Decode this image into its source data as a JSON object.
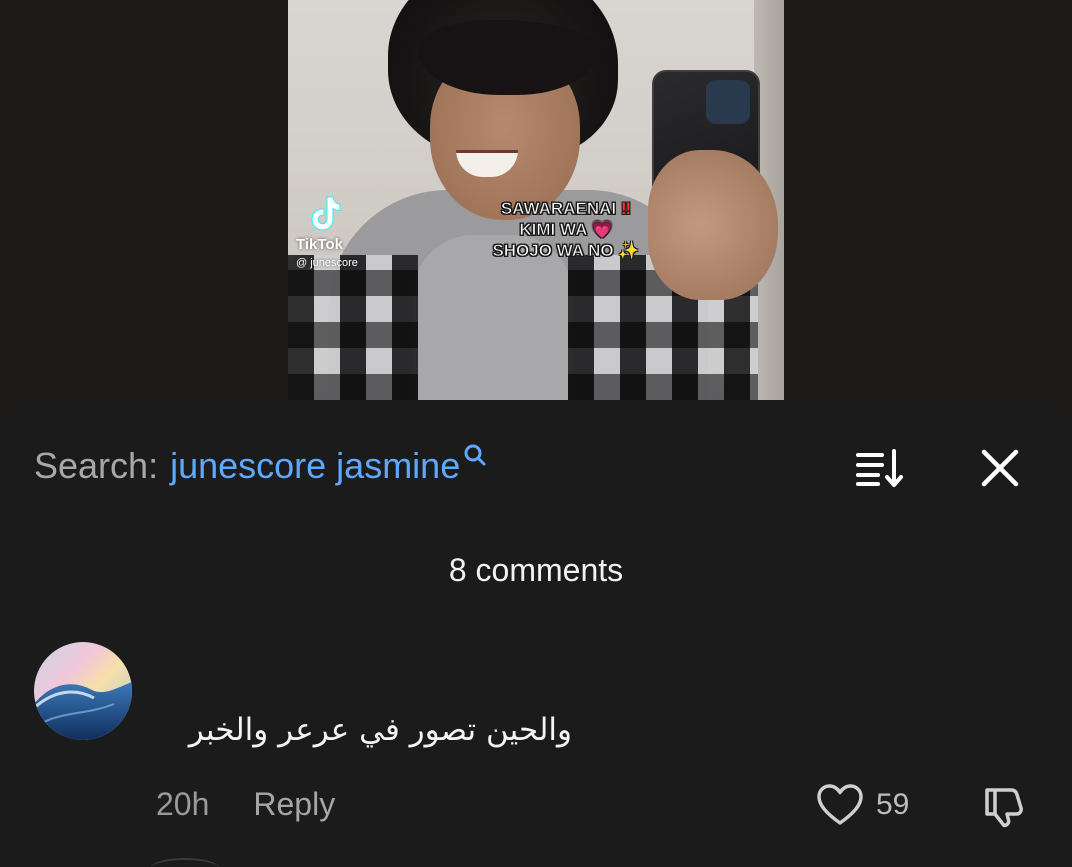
{
  "video": {
    "watermark_app": "TikTok",
    "watermark_user": "@ junescore",
    "caption_lines": [
      "SAWARAENAI",
      "KIMI WA",
      "SHOJO WA NO"
    ],
    "caption_emojis": [
      "‼",
      "💗",
      "✨"
    ]
  },
  "search": {
    "label": "Search:",
    "term": "junescore jasmine",
    "icon": "search-icon",
    "accent_color": "#5ea9ff"
  },
  "header_actions": {
    "sort_icon": "sort-icon",
    "close_icon": "close-icon"
  },
  "comments": {
    "count_label": "8 comments",
    "items": [
      {
        "avatar": "ocean-wave-avatar",
        "text": "والحين تصور في عرعر والخبر",
        "time": "20h",
        "reply_label": "Reply",
        "likes": "59",
        "like_icon": "heart-icon",
        "dislike_icon": "thumbs-down-icon"
      }
    ]
  }
}
